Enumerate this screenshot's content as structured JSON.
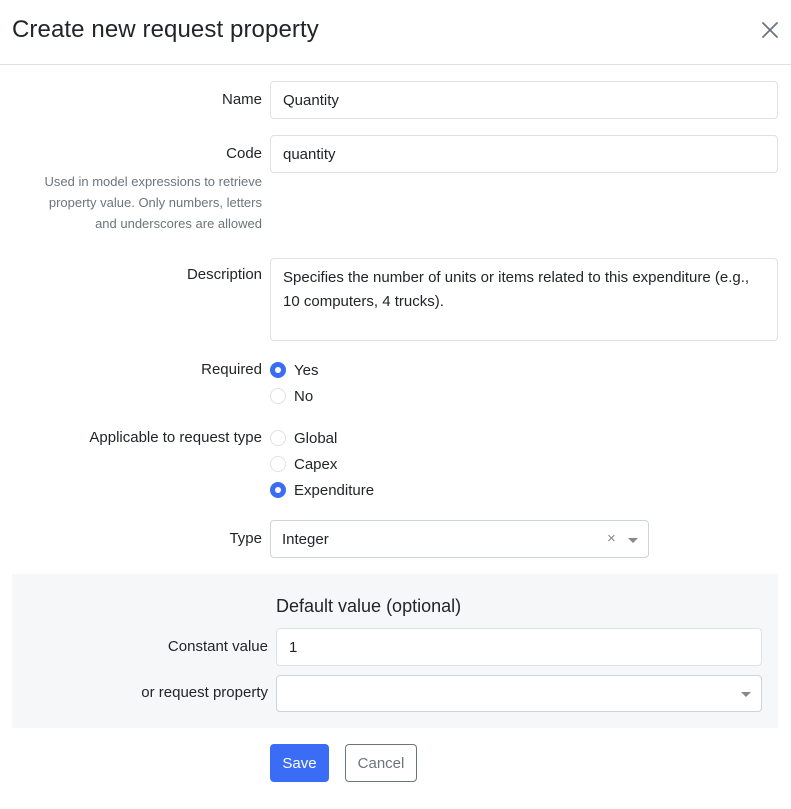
{
  "modal": {
    "title": "Create new request property",
    "close_icon": "close-icon"
  },
  "form": {
    "name": {
      "label": "Name",
      "value": "Quantity"
    },
    "code": {
      "label": "Code",
      "value": "quantity",
      "help_line1": "Used in model expressions to retrieve",
      "help_line2": "property value. Only numbers, letters",
      "help_line3": "and underscores are allowed"
    },
    "description": {
      "label": "Description",
      "value": "Specifies the number of units or items related to this expenditure (e.g., 10 computers, 4 trucks)."
    },
    "required": {
      "label": "Required",
      "options": [
        {
          "label": "Yes",
          "checked": true
        },
        {
          "label": "No",
          "checked": false
        }
      ]
    },
    "request_type": {
      "label": "Applicable to request type",
      "options": [
        {
          "label": "Global",
          "checked": false
        },
        {
          "label": "Capex",
          "checked": false
        },
        {
          "label": "Expenditure",
          "checked": true
        }
      ]
    },
    "type": {
      "label": "Type",
      "value": "Integer",
      "clear_glyph": "×"
    }
  },
  "default_value": {
    "title": "Default value (optional)",
    "constant": {
      "label": "Constant value",
      "value": "1"
    },
    "request_property": {
      "label": "or request property",
      "value": ""
    }
  },
  "buttons": {
    "save": "Save",
    "cancel": "Cancel"
  },
  "colors": {
    "primary": "#3b6cf5",
    "border": "#dee2e6",
    "muted": "#6c757d",
    "panel_bg": "#f6f7f9"
  }
}
